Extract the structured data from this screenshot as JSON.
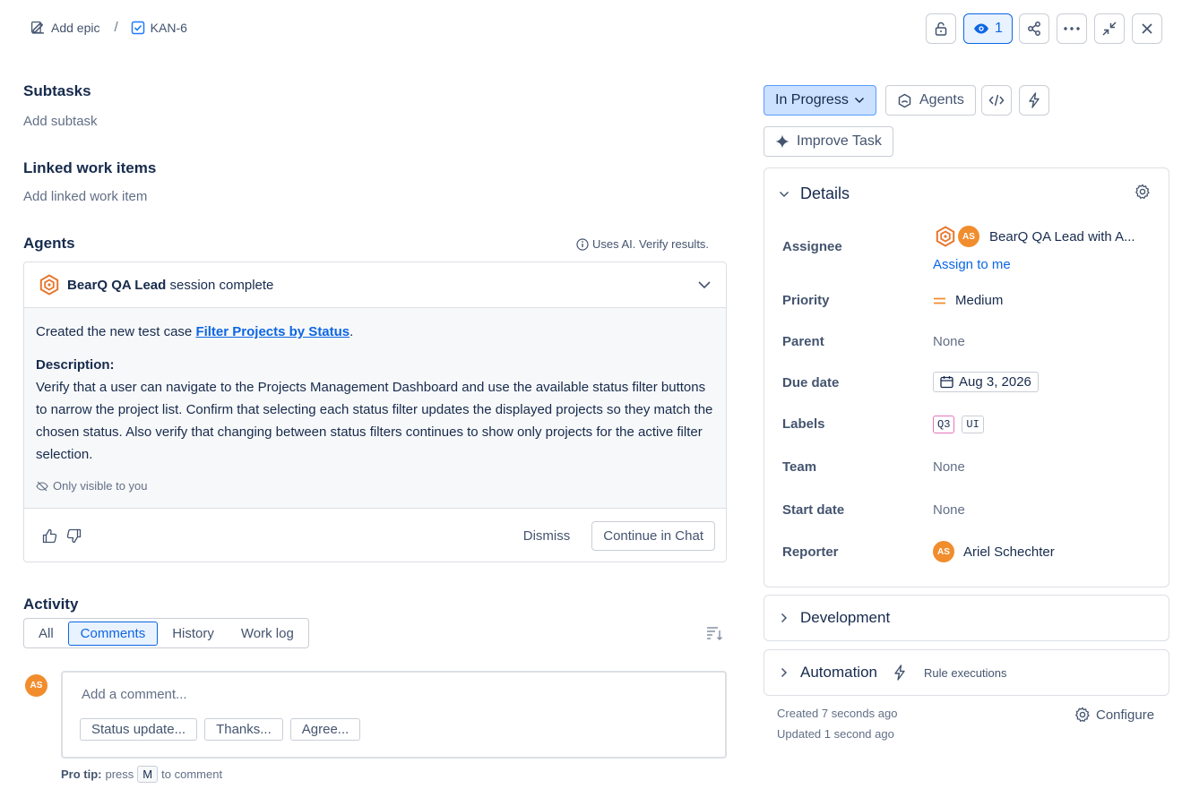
{
  "breadcrumb": {
    "epic_label": "Add epic",
    "separator": "/",
    "issue_key": "KAN-6"
  },
  "toolbar": {
    "watch_count": "1"
  },
  "subtasks": {
    "title": "Subtasks",
    "add_label": "Add subtask"
  },
  "linked": {
    "title": "Linked work items",
    "add_label": "Add linked work item"
  },
  "agents": {
    "title": "Agents",
    "ai_notice": "Uses AI. Verify results.",
    "session": {
      "name": "BearQ QA Lead",
      "status": "session complete"
    },
    "created_prefix": "Created the new test case ",
    "test_case_link": "Filter Projects by Status",
    "created_suffix": ".",
    "description_label": "Description:",
    "description": "Verify that a user can navigate to the Projects Management Dashboard and use the available status filter buttons to narrow the project list. Confirm that selecting each status filter updates the displayed projects so they match the chosen status. Also verify that changing between status filters continues to show only projects for the active filter selection.",
    "visibility_note": "Only visible to you",
    "dismiss_label": "Dismiss",
    "continue_label": "Continue in Chat"
  },
  "activity": {
    "title": "Activity",
    "tabs": [
      "All",
      "Comments",
      "History",
      "Work log"
    ],
    "active_tab": "Comments",
    "comment_placeholder": "Add a comment...",
    "quick_replies": [
      "Status update...",
      "Thanks...",
      "Agree..."
    ],
    "pro_tip_label": "Pro tip:",
    "pro_tip_pre": "press",
    "pro_tip_key": "M",
    "pro_tip_post": "to comment",
    "avatar_initials": "AS"
  },
  "right": {
    "status": "In Progress",
    "agents_label": "Agents",
    "improve_label": "Improve Task",
    "details_title": "Details",
    "fields": {
      "assignee_label": "Assignee",
      "assignee_initials": "AS",
      "assignee_name": "BearQ QA Lead with A...",
      "assign_to_me": "Assign to me",
      "priority_label": "Priority",
      "priority_value": "Medium",
      "parent_label": "Parent",
      "parent_value": "None",
      "due_label": "Due date",
      "due_value": "Aug 3, 2026",
      "labels_label": "Labels",
      "labels": [
        "Q3",
        "UI"
      ],
      "team_label": "Team",
      "team_value": "None",
      "start_label": "Start date",
      "start_value": "None",
      "reporter_label": "Reporter",
      "reporter_initials": "AS",
      "reporter_name": "Ariel Schechter"
    },
    "development_title": "Development",
    "automation_title": "Automation",
    "rule_executions": "Rule executions",
    "created": "Created 7 seconds ago",
    "updated": "Updated 1 second ago",
    "configure_label": "Configure"
  },
  "colors": {
    "accent": "#0c66e4",
    "avatar": "#f18d2d",
    "agent_logo": "#e8762c",
    "priority_medium": "#f18d2d"
  },
  "icons": [
    "edit-icon",
    "checkbox-icon",
    "unlock-icon",
    "eye-icon",
    "share-icon",
    "more-icon",
    "minimize-icon",
    "close-icon",
    "chevron-down-icon",
    "info-icon",
    "agent-logo-icon",
    "thumbs-up-icon",
    "thumbs-down-icon",
    "eye-off-icon",
    "sort-icon",
    "agents-icon",
    "code-icon",
    "lightning-icon",
    "sparkle-icon",
    "gear-icon",
    "priority-medium-icon",
    "calendar-icon",
    "chevron-right-icon"
  ]
}
